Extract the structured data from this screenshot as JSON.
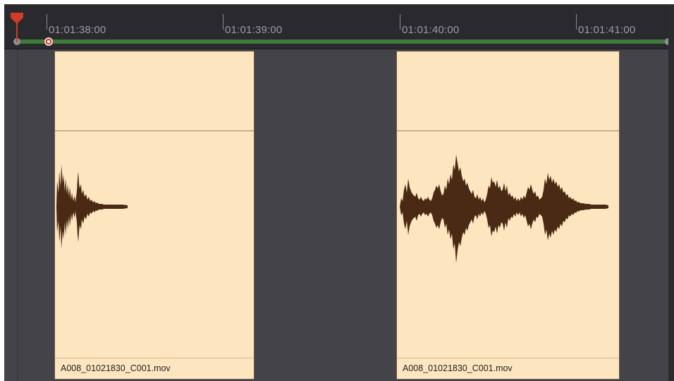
{
  "ruler": {
    "timecodes": [
      "01:01:38:00",
      "01:01:39:00",
      "01:01:40:00",
      "01:01:41:00"
    ]
  },
  "clips": [
    {
      "name": "A008_01021830_C001.mov"
    },
    {
      "name": "A008_01021830_C001.mov"
    }
  ],
  "colors": {
    "track_bg": "#434349",
    "ruler_bg": "#2a2a2e",
    "range_bar": "#3f7a3a",
    "clip_fill": "#fde6bf",
    "waveform": "#4a2a14",
    "playhead": "#d23a2a"
  }
}
